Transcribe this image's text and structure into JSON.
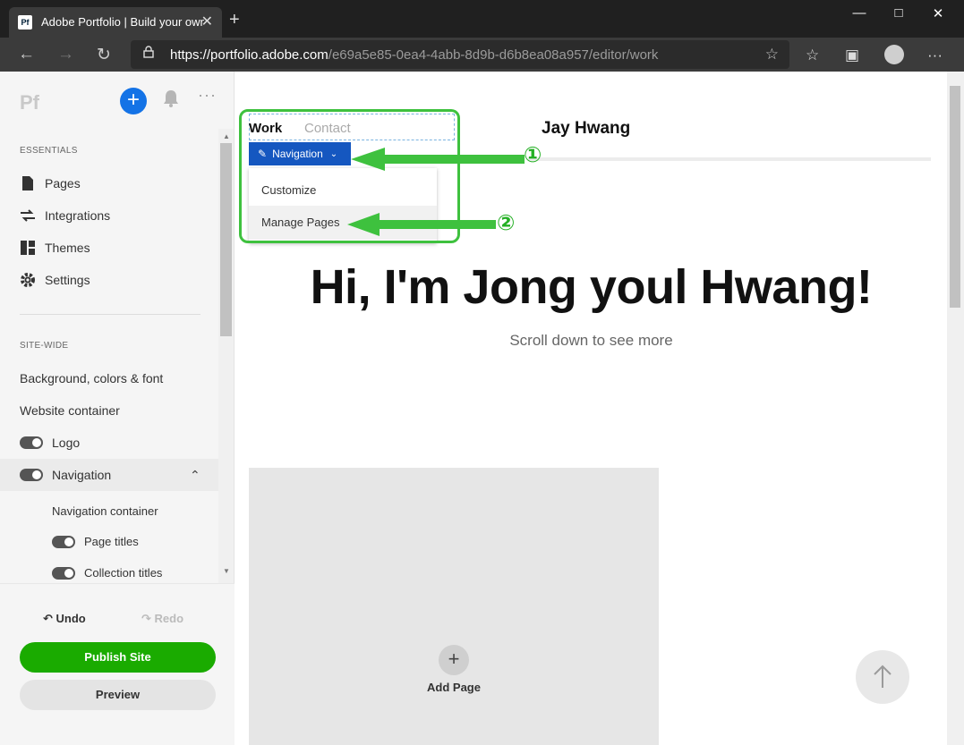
{
  "browser": {
    "tab_title": "Adobe Portfolio | Build your own",
    "tab_favicon": "Pf",
    "tab_close": "✕",
    "new_tab": "+",
    "url_main": "https://portfolio.adobe.com",
    "url_path": "/e69a5e85-0ea4-4abb-8d9b-d6b8ea08a957/editor/work",
    "window_controls": [
      "minimize",
      "maximize",
      "close"
    ]
  },
  "sidebar": {
    "logo": "Pf",
    "add_label": "+",
    "more_label": "···",
    "essentials_label": "ESSENTIALS",
    "essentials": [
      {
        "label": "Pages",
        "icon": "page-icon"
      },
      {
        "label": "Integrations",
        "icon": "integrations-icon"
      },
      {
        "label": "Themes",
        "icon": "themes-icon"
      },
      {
        "label": "Settings",
        "icon": "gear-icon"
      }
    ],
    "sitewide_label": "SITE-WIDE",
    "sitewide": [
      "Background, colors & font",
      "Website container"
    ],
    "toggles": [
      {
        "label": "Logo",
        "on": true
      },
      {
        "label": "Navigation",
        "on": true
      }
    ],
    "nav_children": {
      "container": "Navigation container",
      "page_titles": "Page titles",
      "collection_titles": "Collection titles"
    },
    "undo": "Undo",
    "redo": "Redo",
    "publish": "Publish Site",
    "preview": "Preview"
  },
  "canvas": {
    "nav_links": [
      "Work",
      "Contact"
    ],
    "site_title": "Jay Hwang",
    "nav_button": "Navigation",
    "menu": [
      "Customize",
      "Manage Pages"
    ],
    "hero": "Hi, I'm Jong youl Hwang!",
    "subtitle": "Scroll down to see more",
    "add_page": "Add Page",
    "add_page_plus": "+"
  },
  "annotations": {
    "step1": "①",
    "step2": "②",
    "color": "#3ec13e"
  },
  "colors": {
    "accent_blue": "#1473e6",
    "nav_button": "#1557c0",
    "publish_green": "#1aab00"
  }
}
